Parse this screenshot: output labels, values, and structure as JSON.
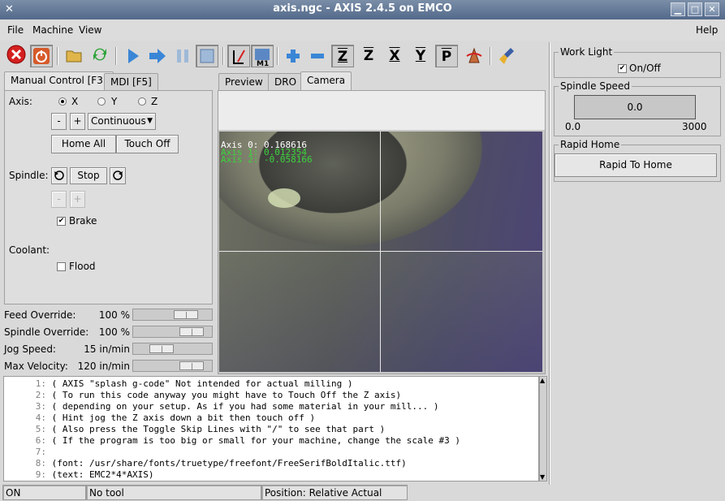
{
  "window": {
    "title": "axis.ngc - AXIS 2.4.5 on EMCO",
    "system_icon": "x-icon"
  },
  "menu": {
    "file": "File",
    "machine": "Machine",
    "view": "View",
    "help": "Help"
  },
  "toolbar": {
    "buttons": [
      "estop-icon",
      "power-icon",
      "open-folder-icon",
      "reload-icon",
      "run-icon",
      "step-icon",
      "pause-icon",
      "stop-icon",
      "skip-lines-icon",
      "optional-stop-icon",
      "zoom-in-icon",
      "zoom-out-icon",
      "view-z-icon",
      "view-z2-icon",
      "view-x-icon",
      "view-y-icon",
      "view-p-icon",
      "rotate-icon",
      "clear-icon"
    ],
    "view_z": "Z",
    "view_z2": "Z",
    "view_x": "X",
    "view_y": "Y",
    "view_p": "P"
  },
  "left_tabs": {
    "manual": "Manual Control [F3]",
    "mdi": "MDI [F5]"
  },
  "manual": {
    "axis_label": "Axis:",
    "axes": [
      "X",
      "Y",
      "Z"
    ],
    "selected_axis": "X",
    "minus": "-",
    "plus": "+",
    "jog_mode": "Continuous",
    "home_all": "Home All",
    "touch_off": "Touch Off",
    "spindle_label": "Spindle:",
    "spindle_stop": "Stop",
    "brake": "Brake",
    "brake_checked": true,
    "coolant_label": "Coolant:",
    "flood": "Flood",
    "flood_checked": false
  },
  "overrides": [
    {
      "label": "Feed Override:",
      "value": "100 %",
      "fraction": 0.77
    },
    {
      "label": "Spindle Override:",
      "value": "100 %",
      "fraction": 0.87
    },
    {
      "label": "Jog Speed:",
      "value": "15 in/min",
      "fraction": 0.3
    },
    {
      "label": "Max Velocity:",
      "value": "120 in/min",
      "fraction": 0.87
    }
  ],
  "view_tabs": {
    "preview": "Preview",
    "dro": "DRO",
    "camera": "Camera"
  },
  "camera": {
    "axis0": "Axis 0: 0.168616",
    "axis1": "Axis 1: 0.012354",
    "axis2": "Axis 2: -0.058166",
    "colors": {
      "axis0": "#ffffff",
      "axis1": "#3cd33c",
      "axis2": "#3cd33c"
    }
  },
  "gcode": [
    {
      "n": "1:",
      "text": "( AXIS \"splash g-code\" Not intended for actual milling )"
    },
    {
      "n": "2:",
      "text": "( To run this code anyway you might have to Touch Off the Z axis)"
    },
    {
      "n": "3:",
      "text": "( depending on your setup. As if you had some material in your mill... )"
    },
    {
      "n": "4:",
      "text": "( Hint jog the Z axis down a bit then touch off )"
    },
    {
      "n": "5:",
      "text": "( Also press the Toggle Skip Lines with \"/\" to see that part )"
    },
    {
      "n": "6:",
      "text": "( If the program is too big or small for your machine, change the scale #3 )"
    },
    {
      "n": "7:",
      "text": ""
    },
    {
      "n": "8:",
      "text": "(font: /usr/share/fonts/truetype/freefont/FreeSerifBoldItalic.ttf)"
    },
    {
      "n": "9:",
      "text": "(text: EMC2*4*AXIS)"
    }
  ],
  "status": {
    "machine": "ON",
    "tool": "No tool",
    "position": "Position: Relative Actual"
  },
  "right": {
    "work_light": "Work Light",
    "on_off": "On/Off",
    "on_off_checked": true,
    "spindle_speed": "Spindle Speed",
    "speed_value": "0.0",
    "speed_min": "0.0",
    "speed_max": "3000",
    "rapid_home": "Rapid Home",
    "rapid_to_home": "Rapid To Home"
  }
}
